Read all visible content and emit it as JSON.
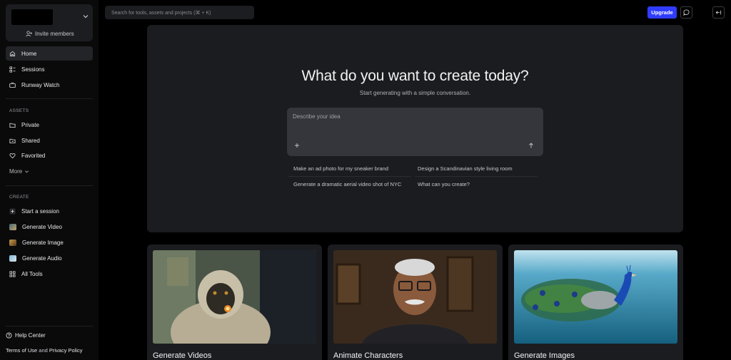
{
  "workspace": {
    "invite_label": "Invite members"
  },
  "nav": {
    "home": "Home",
    "sessions": "Sessions",
    "runway_watch": "Runway Watch"
  },
  "assets": {
    "label": "ASSETS",
    "private": "Private",
    "shared": "Shared",
    "favorited": "Favorited",
    "more": "More"
  },
  "create": {
    "label": "CREATE",
    "start_session": "Start a session",
    "generate_video": "Generate Video",
    "generate_image": "Generate Image",
    "generate_audio": "Generate Audio",
    "all_tools": "All Tools"
  },
  "footer": {
    "help_center": "Help Center",
    "terms": "Terms of Use",
    "and": " and ",
    "privacy": "Privacy Policy"
  },
  "topbar": {
    "search_placeholder": "Search for tools, assets and projects (⌘ + K)",
    "upgrade_label": "Upgrade"
  },
  "hero": {
    "title": "What do you want to create today?",
    "subtitle": "Start generating with a simple conversation.",
    "prompt_placeholder": "Describe your idea",
    "suggestions": [
      "Make an ad photo for my sneaker brand",
      "Design a Scandinavian style living room",
      "Generate a dramatic aerial video shot of NYC",
      "What can you create?"
    ]
  },
  "cards": [
    {
      "title": "Generate Videos"
    },
    {
      "title": "Animate Characters"
    },
    {
      "title": "Generate Images"
    }
  ],
  "colors": {
    "accent": "#2f3cff",
    "background": "#000000",
    "panel": "#1b1c1f",
    "prompt_box": "#34363b"
  }
}
